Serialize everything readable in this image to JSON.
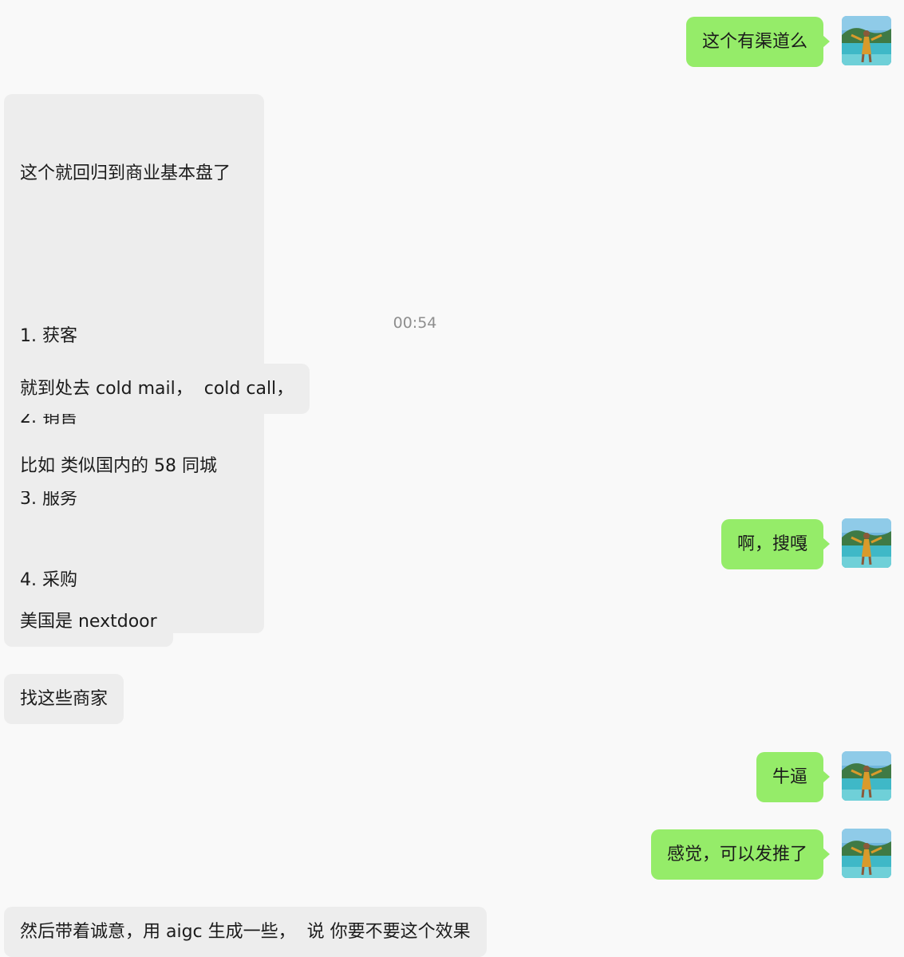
{
  "chat": {
    "timestamp": "00:54",
    "messages": [
      {
        "from": "me",
        "text": "这个有渠道么"
      },
      {
        "from": "other",
        "lines": [
          "这个就回归到商业基本盘了",
          "",
          "1. 获客",
          "2. 销售",
          "3. 服务",
          "4. 采购"
        ]
      },
      {
        "from": "other",
        "text": "就到处去 cold mail，  cold call，"
      },
      {
        "from": "other",
        "text": "比如 类似国内的 58 同城"
      },
      {
        "from": "me",
        "text": "啊，搜嘎"
      },
      {
        "from": "other",
        "text": "美国是 nextdoor"
      },
      {
        "from": "other",
        "text": "找这些商家"
      },
      {
        "from": "me",
        "text": "牛逼"
      },
      {
        "from": "me",
        "text": "感觉，可以发推了"
      },
      {
        "from": "other",
        "text": "然后带着诚意，用 aigc 生成一些，  说 你要不要这个效果"
      }
    ]
  },
  "colors": {
    "background": "#f9f9f9",
    "outgoing_bubble": "#95ec69",
    "incoming_bubble": "#ededed",
    "timestamp_text": "#8e8e8e"
  },
  "icons": {
    "avatar": "user-avatar-photo-beach"
  }
}
